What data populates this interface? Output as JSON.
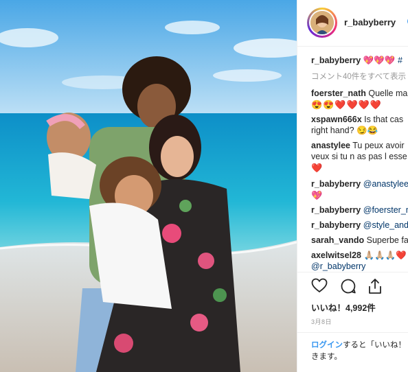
{
  "post": {
    "photo_alt": "",
    "author": "r_babyberry",
    "caption_user": "r_babyberry",
    "caption_emojis": "💖💖💖",
    "caption_tail": "#",
    "view_all_comments": "コメント40件をすべて表示",
    "comments": [
      {
        "user": "foerster_nath",
        "text": "Quelle ma",
        "extra": "😍😍❤️❤️❤️❤️"
      },
      {
        "user": "xspawn666x",
        "text": "Is that cas",
        "extra": "right hand? 😏😂"
      },
      {
        "user": "anastylee",
        "text": "Tu peux avoir",
        "extra": "veux si tu n as pas l esse",
        "extra2": "❤️"
      },
      {
        "user": "r_babyberry",
        "text": "@anastylee",
        "extra": "💖"
      },
      {
        "user": "r_babyberry",
        "text": "@foerster_n"
      },
      {
        "user": "r_babyberry",
        "text": "@style_and"
      },
      {
        "user": "sarah_vando",
        "text": "Superbe fa"
      },
      {
        "user": "axelwitsel28",
        "text": "🙏🏼🙏🏼🙏🏼❤️",
        "extra": "@r_babyberry"
      }
    ],
    "likes": "いいね！4,992件",
    "date": "3月8日",
    "login_link": "ログイン",
    "login_text": "すると「いいね！",
    "login_text2": "きます。"
  },
  "icons": {
    "like": "heart-icon",
    "comment": "comment-icon",
    "share": "share-icon",
    "verified": "verified-badge-icon"
  },
  "colors": {
    "link": "#3897f0",
    "mention": "#003569",
    "text": "#262626",
    "muted": "#999999",
    "verified": "#3897f0"
  }
}
